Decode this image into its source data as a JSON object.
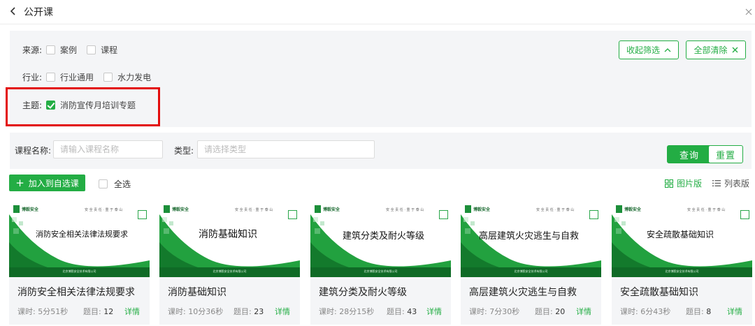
{
  "header": {
    "title": "公开课"
  },
  "filters": {
    "source": {
      "label": "来源:",
      "options": [
        "案例",
        "课程"
      ]
    },
    "industry": {
      "label": "行业:",
      "options": [
        "行业通用",
        "水力发电"
      ]
    },
    "topic": {
      "label": "主题:",
      "options": [
        {
          "label": "消防宣传月培训专题",
          "checked": true
        }
      ]
    },
    "collapse_label": "收起筛选",
    "clear_label": "全部清除"
  },
  "search": {
    "name_label": "课程名称:",
    "name_placeholder": "请输入课程名称",
    "type_label": "类型:",
    "type_placeholder": "请选择类型",
    "query_label": "查询",
    "reset_label": "重置"
  },
  "toolbar": {
    "add_label": "加入到自选课",
    "select_all_label": "全选",
    "grid_view_label": "图片版",
    "list_view_label": "列表版"
  },
  "cover": {
    "logo_text": "博毅安全",
    "slogan": "安 全 责 任 · 重 于 泰 山",
    "footer": "北京博毅安全技术有限公司"
  },
  "courses": [
    {
      "title": "消防安全相关法律法规要求",
      "duration_label": "课时:",
      "duration": "5分51秒",
      "questions_label": "题目:",
      "questions": "12",
      "detail_label": "详情"
    },
    {
      "title": "消防基础知识",
      "duration_label": "课时:",
      "duration": "10分36秒",
      "questions_label": "题目:",
      "questions": "23",
      "detail_label": "详情"
    },
    {
      "title": "建筑分类及耐火等级",
      "duration_label": "课时:",
      "duration": "28分15秒",
      "questions_label": "题目:",
      "questions": "43",
      "detail_label": "详情"
    },
    {
      "title": "高层建筑火灾逃生与自救",
      "duration_label": "课时:",
      "duration": "7分30秒",
      "questions_label": "题目:",
      "questions": "20",
      "detail_label": "详情"
    },
    {
      "title": "安全疏散基础知识",
      "duration_label": "课时:",
      "duration": "6分43秒",
      "questions_label": "题目:",
      "questions": "8",
      "detail_label": "详情"
    }
  ],
  "colors": {
    "accent": "#23ad44",
    "highlight": "#e30d0d",
    "panel": "#f4f5f7"
  }
}
